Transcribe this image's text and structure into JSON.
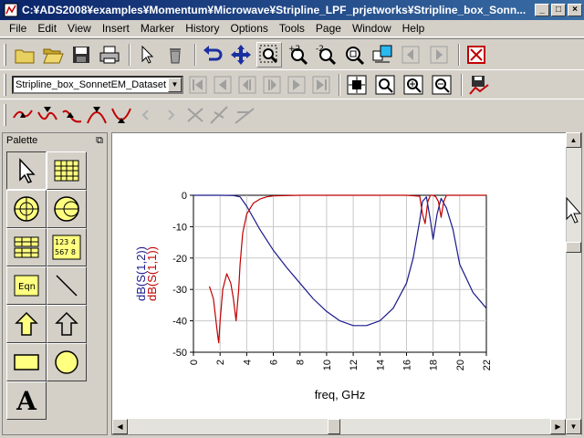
{
  "window": {
    "title": "C:¥ADS2008¥examples¥Momentum¥Microwave¥Stripline_LPF_prjetworks¥Stripline_box_Sonn...",
    "min": "_",
    "max": "□",
    "close": "×"
  },
  "menu": [
    "File",
    "Edit",
    "View",
    "Insert",
    "Marker",
    "History",
    "Options",
    "Tools",
    "Page",
    "Window",
    "Help"
  ],
  "dataset": {
    "value": "Stripline_box_SonnetEM_Dataset"
  },
  "palette": {
    "title": "Palette",
    "dock": "⧉",
    "text_tool": "A",
    "eqn_label": "Eqn",
    "table_label_a": "123 4",
    "table_label_b": "567 8"
  },
  "colors": {
    "s12": "#1a1a8c",
    "s11": "#c00000",
    "grid": "#c8c8c8",
    "accent": "#0a246a"
  },
  "chart_data": {
    "type": "line",
    "xlabel": "freq, GHz",
    "ylabel_s12": "dB(S(1,2))",
    "ylabel_s11": "dB(S(1,1))",
    "xlim": [
      0,
      22
    ],
    "ylim": [
      -50,
      0
    ],
    "xticks": [
      "0",
      "2",
      "4",
      "6",
      "8",
      "10",
      "12",
      "14",
      "16",
      "18",
      "20",
      "22"
    ],
    "yticks": [
      "0",
      "-10",
      "-20",
      "-30",
      "-40",
      "-50"
    ],
    "series": [
      {
        "name": "dB(S(1,2))",
        "x": [
          0,
          1,
          2,
          3,
          3.5,
          4,
          5,
          6,
          7,
          8,
          9,
          10,
          11,
          12,
          13,
          14,
          15,
          16,
          16.5,
          17,
          17.2,
          17.5,
          17.8,
          18,
          18.3,
          18.6,
          19,
          19.5,
          20,
          21,
          22
        ],
        "values": [
          0,
          0,
          0,
          -0.1,
          -0.5,
          -3.5,
          -11,
          -17.5,
          -23,
          -28,
          -33,
          -37,
          -40,
          -41.5,
          -41.5,
          -40,
          -36,
          -28,
          -20,
          -8,
          -2,
          -0.5,
          -8,
          -14,
          -6,
          -1,
          -4,
          -11,
          -22,
          -31,
          -36
        ]
      },
      {
        "name": "dB(S(1,1))",
        "x": [
          1.2,
          1.5,
          1.8,
          1.9,
          2.0,
          2.2,
          2.5,
          2.8,
          3.0,
          3.2,
          3.4,
          3.5,
          3.7,
          4.0,
          4.5,
          5,
          5.5,
          6,
          8,
          10,
          12,
          14,
          16,
          17.0,
          17.2,
          17.4,
          17.6,
          17.8,
          18,
          18.2,
          18.4,
          18.6,
          18.8,
          19,
          20,
          22
        ],
        "values": [
          -29,
          -33,
          -44,
          -47,
          -40,
          -30,
          -25,
          -28,
          -33,
          -40,
          -30,
          -22,
          -12,
          -6,
          -2.5,
          -1.2,
          -0.5,
          -0.2,
          0,
          0,
          0,
          0,
          0,
          -0.3,
          -6,
          -9,
          -2,
          0,
          0,
          -0.5,
          -2,
          -7,
          -2,
          0,
          0,
          0
        ]
      }
    ]
  }
}
